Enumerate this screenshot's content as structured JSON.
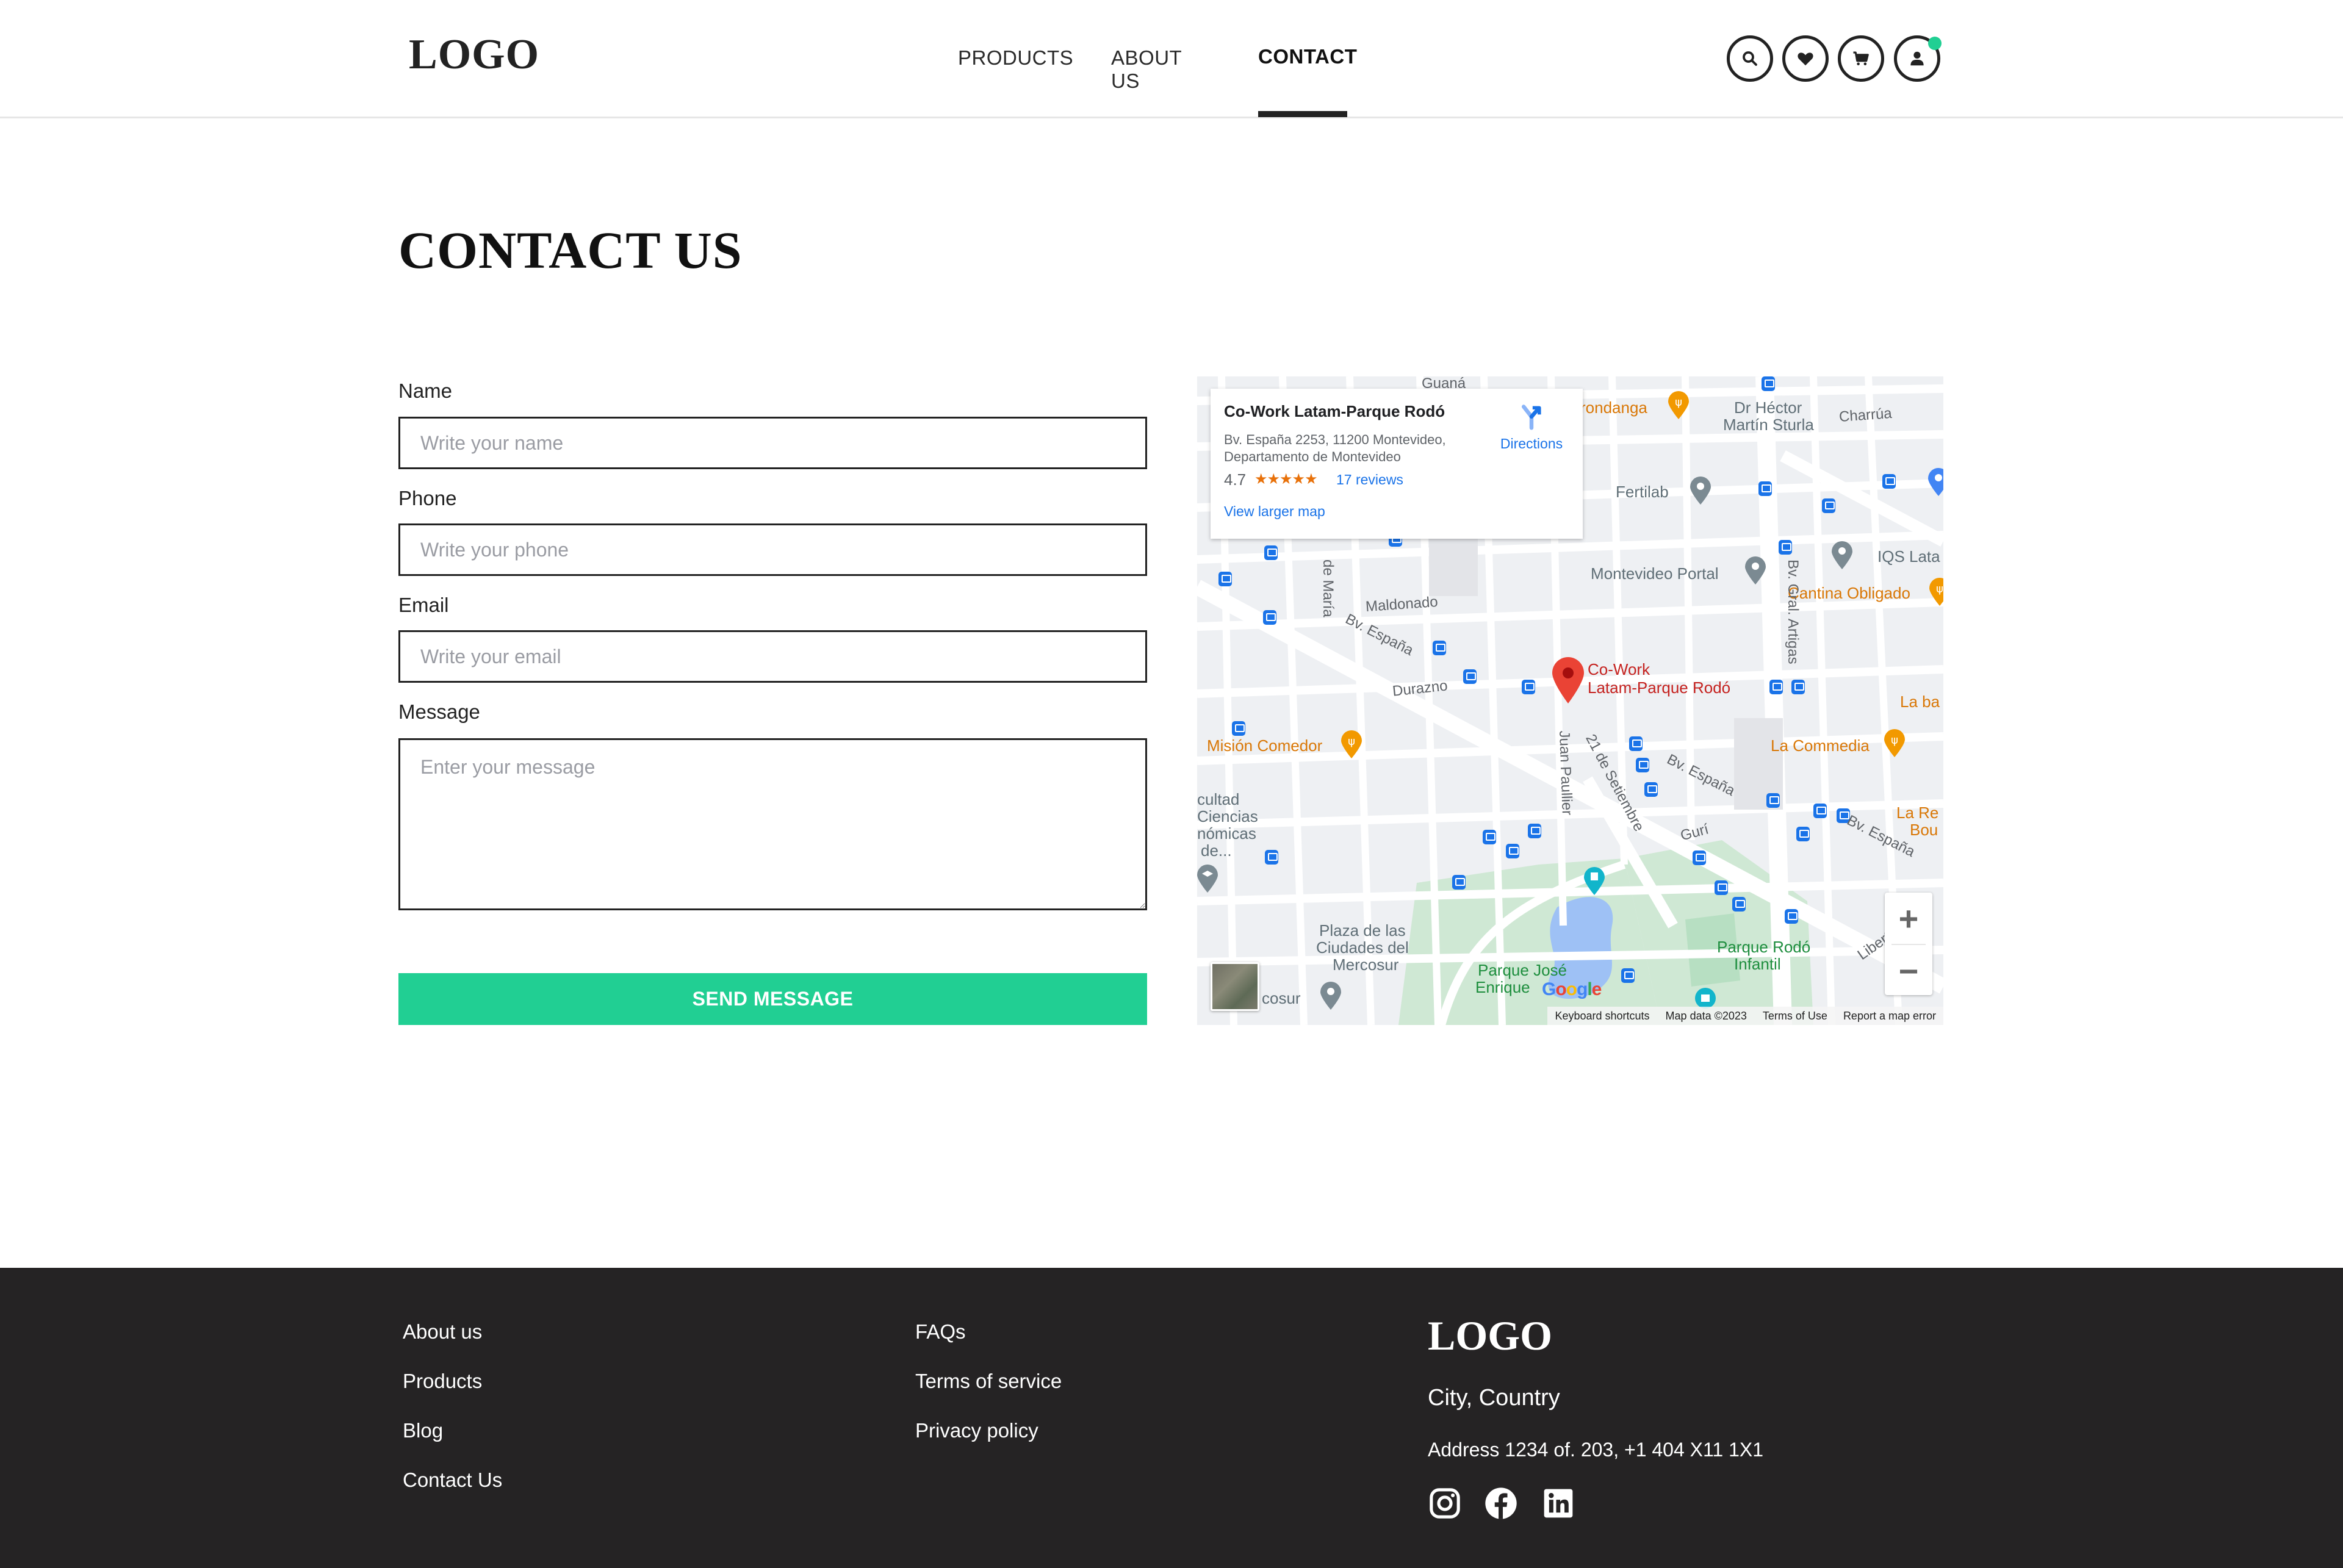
{
  "header": {
    "logo": "LOGO",
    "nav": [
      {
        "label": "PRODUCTS",
        "active": false
      },
      {
        "label": "ABOUT US",
        "active": false
      },
      {
        "label": "CONTACT",
        "active": true
      }
    ],
    "icons": [
      "search-icon",
      "heart-icon",
      "cart-icon",
      "user-icon"
    ],
    "notification_color": "#21cf93"
  },
  "page": {
    "title": "CONTACT US"
  },
  "form": {
    "name": {
      "label": "Name",
      "placeholder": "Write your name",
      "value": ""
    },
    "phone": {
      "label": "Phone",
      "placeholder": "Write your phone",
      "value": ""
    },
    "email": {
      "label": "Email",
      "placeholder": "Write your email",
      "value": ""
    },
    "message": {
      "label": "Message",
      "placeholder": "Enter your message",
      "value": ""
    },
    "submit_label": "SEND MESSAGE",
    "accent_color": "#21cf93"
  },
  "map": {
    "place_name": "Co-Work Latam-Parque Rodó",
    "address": "Bv. España 2253, 11200 Montevideo, Departamento de Montevideo",
    "rating": "4.7",
    "stars": "★★★★★",
    "reviews": "17 reviews",
    "directions": "Directions",
    "view_larger": "View larger map",
    "marker_label_line1": "Co-Work",
    "marker_label_line2": "Latam-Parque Rodó",
    "labels": {
      "guana": "Guaná",
      "rondanga": "rondanga",
      "hector_1": "Dr Héctor",
      "hector_2": "Martín Sturla",
      "charrua": "Charrúa",
      "fertilab": "Fertilab",
      "iqs": "IQS Lata",
      "montevideo_portal": "Montevideo Portal",
      "cantina": "Cantina Obligado",
      "de_maria": "de María",
      "maldonado": "Maldonado",
      "bv_espana": "Bv. España",
      "artigas": "Bv. Gral. Artigas",
      "durazno": "Durazno",
      "la_ba": "La ba",
      "mision": "Misión Comedor",
      "la_commedia": "La Commedia",
      "juan_paullier": "Juan Paullier",
      "setiembre": "21 de Setiembre",
      "facultad_1": "cultad",
      "facultad_2": "Ciencias",
      "facultad_3": "nómicas",
      "facultad_4": "de...",
      "la_re_1": "La Re",
      "la_re_2": "Bou",
      "guri": "Gurí",
      "plaza_1": "Plaza de las",
      "plaza_2": "Ciudades del",
      "plaza_3": "Mercosur",
      "parque_jose_1": "Parque José",
      "parque_jose_2": "Enrique",
      "parque_rodo_1": "Parque Rodó",
      "parque_rodo_2": "Infantil",
      "mercosur_bottom": "cosur",
      "libertad": "Libert"
    },
    "footer": {
      "shortcuts": "Keyboard shortcuts",
      "data": "Map data ©2023",
      "terms": "Terms of Use",
      "report": "Report a map error"
    },
    "zoom_in": "+",
    "zoom_out": "−"
  },
  "footer": {
    "col1": [
      "About us",
      "Products",
      "Blog",
      "Contact Us"
    ],
    "col2": [
      "FAQs",
      "Terms of service",
      "Privacy policy"
    ],
    "logo": "LOGO",
    "city": "City, Country",
    "address": "Address 1234 of. 203, +1 404 X11 1X1",
    "social": [
      "instagram-icon",
      "facebook-icon",
      "linkedin-icon"
    ]
  }
}
